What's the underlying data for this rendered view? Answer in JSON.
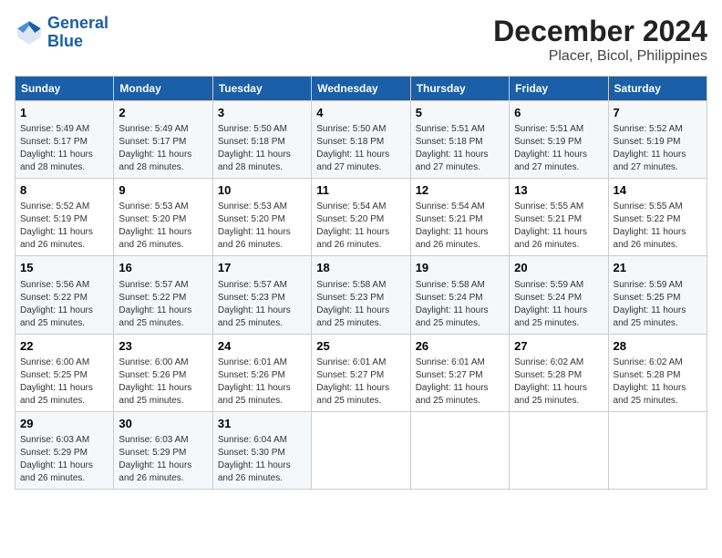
{
  "logo": {
    "name_part1": "General",
    "name_part2": "Blue"
  },
  "title": "December 2024",
  "subtitle": "Placer, Bicol, Philippines",
  "headers": [
    "Sunday",
    "Monday",
    "Tuesday",
    "Wednesday",
    "Thursday",
    "Friday",
    "Saturday"
  ],
  "weeks": [
    [
      {
        "day": "1",
        "info": "Sunrise: 5:49 AM\nSunset: 5:17 PM\nDaylight: 11 hours\nand 28 minutes."
      },
      {
        "day": "2",
        "info": "Sunrise: 5:49 AM\nSunset: 5:17 PM\nDaylight: 11 hours\nand 28 minutes."
      },
      {
        "day": "3",
        "info": "Sunrise: 5:50 AM\nSunset: 5:18 PM\nDaylight: 11 hours\nand 28 minutes."
      },
      {
        "day": "4",
        "info": "Sunrise: 5:50 AM\nSunset: 5:18 PM\nDaylight: 11 hours\nand 27 minutes."
      },
      {
        "day": "5",
        "info": "Sunrise: 5:51 AM\nSunset: 5:18 PM\nDaylight: 11 hours\nand 27 minutes."
      },
      {
        "day": "6",
        "info": "Sunrise: 5:51 AM\nSunset: 5:19 PM\nDaylight: 11 hours\nand 27 minutes."
      },
      {
        "day": "7",
        "info": "Sunrise: 5:52 AM\nSunset: 5:19 PM\nDaylight: 11 hours\nand 27 minutes."
      }
    ],
    [
      {
        "day": "8",
        "info": "Sunrise: 5:52 AM\nSunset: 5:19 PM\nDaylight: 11 hours\nand 26 minutes."
      },
      {
        "day": "9",
        "info": "Sunrise: 5:53 AM\nSunset: 5:20 PM\nDaylight: 11 hours\nand 26 minutes."
      },
      {
        "day": "10",
        "info": "Sunrise: 5:53 AM\nSunset: 5:20 PM\nDaylight: 11 hours\nand 26 minutes."
      },
      {
        "day": "11",
        "info": "Sunrise: 5:54 AM\nSunset: 5:20 PM\nDaylight: 11 hours\nand 26 minutes."
      },
      {
        "day": "12",
        "info": "Sunrise: 5:54 AM\nSunset: 5:21 PM\nDaylight: 11 hours\nand 26 minutes."
      },
      {
        "day": "13",
        "info": "Sunrise: 5:55 AM\nSunset: 5:21 PM\nDaylight: 11 hours\nand 26 minutes."
      },
      {
        "day": "14",
        "info": "Sunrise: 5:55 AM\nSunset: 5:22 PM\nDaylight: 11 hours\nand 26 minutes."
      }
    ],
    [
      {
        "day": "15",
        "info": "Sunrise: 5:56 AM\nSunset: 5:22 PM\nDaylight: 11 hours\nand 25 minutes."
      },
      {
        "day": "16",
        "info": "Sunrise: 5:57 AM\nSunset: 5:22 PM\nDaylight: 11 hours\nand 25 minutes."
      },
      {
        "day": "17",
        "info": "Sunrise: 5:57 AM\nSunset: 5:23 PM\nDaylight: 11 hours\nand 25 minutes."
      },
      {
        "day": "18",
        "info": "Sunrise: 5:58 AM\nSunset: 5:23 PM\nDaylight: 11 hours\nand 25 minutes."
      },
      {
        "day": "19",
        "info": "Sunrise: 5:58 AM\nSunset: 5:24 PM\nDaylight: 11 hours\nand 25 minutes."
      },
      {
        "day": "20",
        "info": "Sunrise: 5:59 AM\nSunset: 5:24 PM\nDaylight: 11 hours\nand 25 minutes."
      },
      {
        "day": "21",
        "info": "Sunrise: 5:59 AM\nSunset: 5:25 PM\nDaylight: 11 hours\nand 25 minutes."
      }
    ],
    [
      {
        "day": "22",
        "info": "Sunrise: 6:00 AM\nSunset: 5:25 PM\nDaylight: 11 hours\nand 25 minutes."
      },
      {
        "day": "23",
        "info": "Sunrise: 6:00 AM\nSunset: 5:26 PM\nDaylight: 11 hours\nand 25 minutes."
      },
      {
        "day": "24",
        "info": "Sunrise: 6:01 AM\nSunset: 5:26 PM\nDaylight: 11 hours\nand 25 minutes."
      },
      {
        "day": "25",
        "info": "Sunrise: 6:01 AM\nSunset: 5:27 PM\nDaylight: 11 hours\nand 25 minutes."
      },
      {
        "day": "26",
        "info": "Sunrise: 6:01 AM\nSunset: 5:27 PM\nDaylight: 11 hours\nand 25 minutes."
      },
      {
        "day": "27",
        "info": "Sunrise: 6:02 AM\nSunset: 5:28 PM\nDaylight: 11 hours\nand 25 minutes."
      },
      {
        "day": "28",
        "info": "Sunrise: 6:02 AM\nSunset: 5:28 PM\nDaylight: 11 hours\nand 25 minutes."
      }
    ],
    [
      {
        "day": "29",
        "info": "Sunrise: 6:03 AM\nSunset: 5:29 PM\nDaylight: 11 hours\nand 26 minutes."
      },
      {
        "day": "30",
        "info": "Sunrise: 6:03 AM\nSunset: 5:29 PM\nDaylight: 11 hours\nand 26 minutes."
      },
      {
        "day": "31",
        "info": "Sunrise: 6:04 AM\nSunset: 5:30 PM\nDaylight: 11 hours\nand 26 minutes."
      },
      {
        "day": "",
        "info": ""
      },
      {
        "day": "",
        "info": ""
      },
      {
        "day": "",
        "info": ""
      },
      {
        "day": "",
        "info": ""
      }
    ]
  ]
}
